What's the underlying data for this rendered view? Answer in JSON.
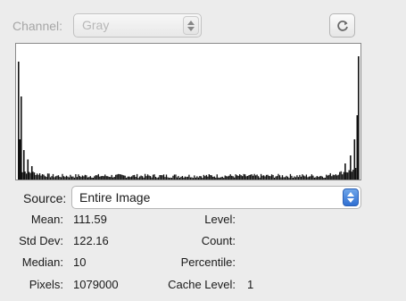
{
  "channel": {
    "label": "Channel:",
    "value": "Gray"
  },
  "source": {
    "label": "Source:",
    "value": "Entire Image"
  },
  "refresh": {
    "icon": "refresh-icon"
  },
  "stats_left": [
    {
      "key": "Mean:",
      "value": "111.59"
    },
    {
      "key": "Std Dev:",
      "value": "122.16"
    },
    {
      "key": "Median:",
      "value": "10"
    },
    {
      "key": "Pixels:",
      "value": "1079000"
    }
  ],
  "stats_right": [
    {
      "key": "Level:",
      "value": ""
    },
    {
      "key": "Count:",
      "value": ""
    },
    {
      "key": "Percentile:",
      "value": ""
    },
    {
      "key": "Cache Level:",
      "value": "1"
    }
  ],
  "chart_data": {
    "type": "bar",
    "title": "",
    "xlim": [
      0,
      255
    ],
    "ylim": [
      0,
      1
    ],
    "spikes": [
      {
        "x": 0,
        "y": 0.88
      },
      {
        "x": 1,
        "y": 0.3
      },
      {
        "x": 2,
        "y": 0.62
      },
      {
        "x": 4,
        "y": 0.22
      },
      {
        "x": 7,
        "y": 0.15
      },
      {
        "x": 10,
        "y": 0.1
      },
      {
        "x": 245,
        "y": 0.12
      },
      {
        "x": 249,
        "y": 0.18
      },
      {
        "x": 252,
        "y": 0.3
      },
      {
        "x": 254,
        "y": 0.48
      },
      {
        "x": 255,
        "y": 0.92
      }
    ],
    "colors": {
      "bars": "#111111",
      "background": "#ffffff"
    }
  }
}
